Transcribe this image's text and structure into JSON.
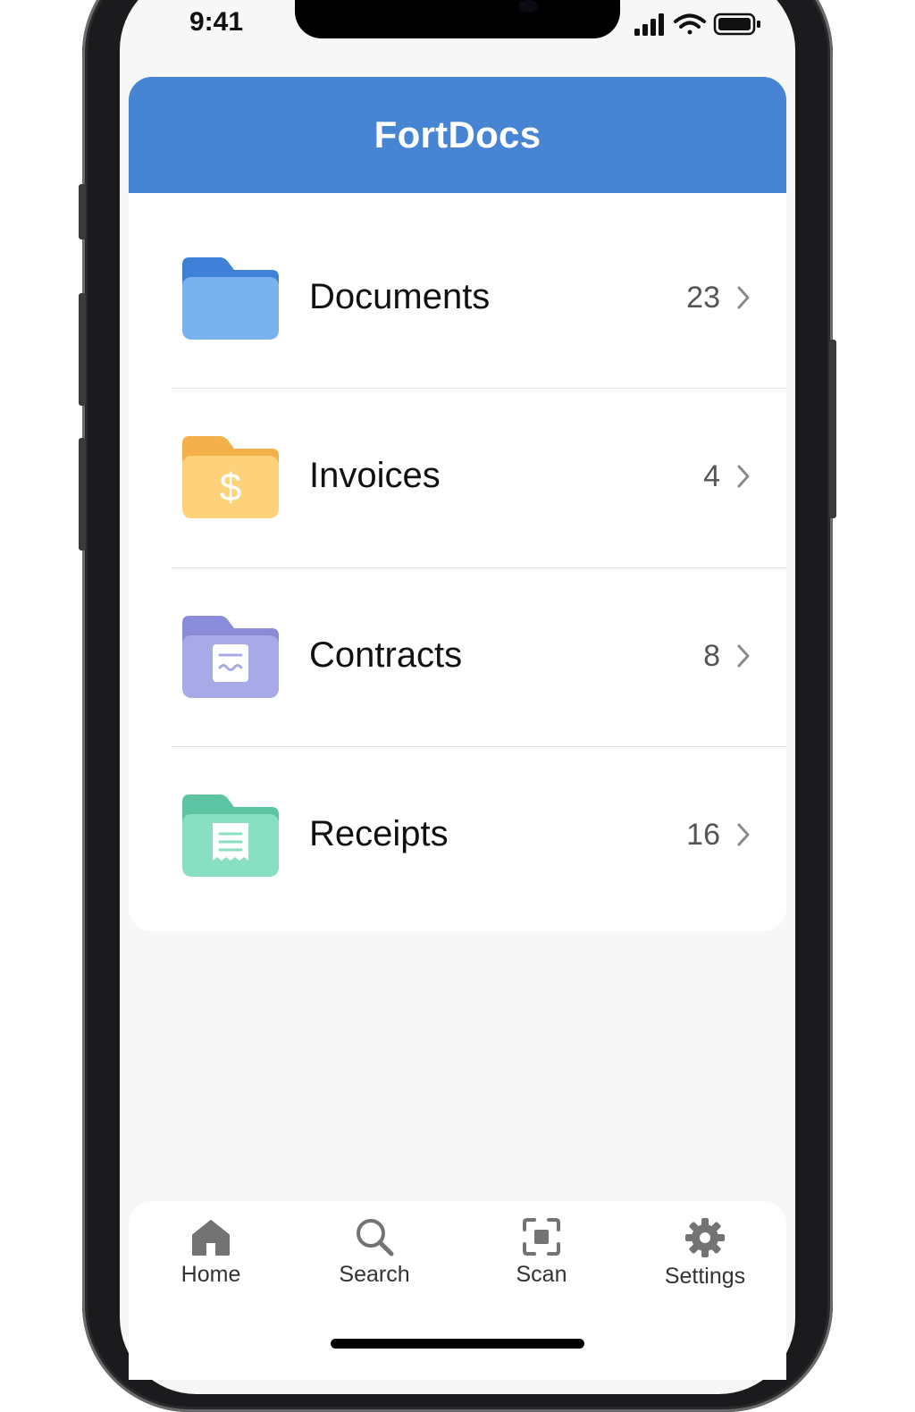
{
  "status_bar": {
    "time": "9:41"
  },
  "app": {
    "title": "FortDocs",
    "accent": "#4785d4"
  },
  "folders": [
    {
      "label": "Documents",
      "count": "23",
      "icon": "folder-icon",
      "color": "#6fa9ea"
    },
    {
      "label": "Invoices",
      "count": "4",
      "icon": "invoice-folder-icon",
      "color": "#fcd06f",
      "glyph": "$"
    },
    {
      "label": "Contracts",
      "count": "8",
      "icon": "contract-folder-icon",
      "color": "#a5a7e6"
    },
    {
      "label": "Receipts",
      "count": "16",
      "icon": "receipt-folder-icon",
      "color": "#85dcbd"
    }
  ],
  "tabs": [
    {
      "label": "Home",
      "icon": "home-icon"
    },
    {
      "label": "Search",
      "icon": "search-icon"
    },
    {
      "label": "Scan",
      "icon": "scan-icon"
    },
    {
      "label": "Settings",
      "icon": "gear-icon"
    }
  ]
}
